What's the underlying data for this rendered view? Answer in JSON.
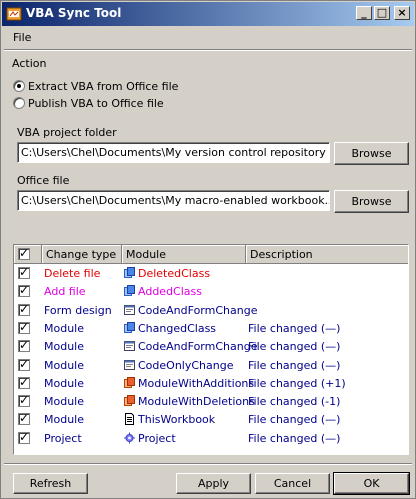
{
  "window": {
    "title": "VBA Sync Tool"
  },
  "menu": {
    "file": "File"
  },
  "action": {
    "label": "Action",
    "extract": "Extract VBA from Office file",
    "publish": "Publish VBA to Office file",
    "selected": "extract"
  },
  "folder": {
    "label": "VBA project folder",
    "value": "C:\\Users\\Chel\\Documents\\My version control repository",
    "browse": "Browse"
  },
  "office": {
    "label": "Office file",
    "value": "C:\\Users\\Chel\\Documents\\My macro-enabled workbook.xlsm",
    "browse": "Browse"
  },
  "list": {
    "columns": [
      "Change type",
      "Module",
      "Description"
    ],
    "rows": [
      {
        "type": "Delete file",
        "module": "DeletedClass",
        "desc": "",
        "color": "#e00000",
        "icon": "class-icon"
      },
      {
        "type": "Add file",
        "module": "AddedClass",
        "desc": "",
        "color": "#e000e0",
        "icon": "class-icon"
      },
      {
        "type": "Form design",
        "module": "CodeAndFormChange",
        "desc": "",
        "color": "#00008b",
        "icon": "form-icon"
      },
      {
        "type": "Module",
        "module": "ChangedClass",
        "desc": "File changed (—)",
        "color": "#00008b",
        "icon": "class-icon"
      },
      {
        "type": "Module",
        "module": "CodeAndFormChange",
        "desc": "File changed (—)",
        "color": "#00008b",
        "icon": "form-icon"
      },
      {
        "type": "Module",
        "module": "CodeOnlyChange",
        "desc": "File changed (—)",
        "color": "#00008b",
        "icon": "form-icon"
      },
      {
        "type": "Module",
        "module": "ModuleWithAdditions",
        "desc": "File changed (+1)",
        "color": "#00008b",
        "icon": "module-icon"
      },
      {
        "type": "Module",
        "module": "ModuleWithDeletions",
        "desc": "File changed (-1)",
        "color": "#00008b",
        "icon": "module-icon"
      },
      {
        "type": "Module",
        "module": "ThisWorkbook",
        "desc": "File changed (—)",
        "color": "#00008b",
        "icon": "document-icon"
      },
      {
        "type": "Project",
        "module": "Project",
        "desc": "File changed (—)",
        "color": "#00008b",
        "icon": "project-icon"
      }
    ]
  },
  "buttons": {
    "refresh": "Refresh",
    "apply": "Apply",
    "cancel": "Cancel",
    "ok": "OK"
  },
  "colors": {
    "titlebar": "#0a246a",
    "delete": "#e00000",
    "add": "#e000e0",
    "normal": "#00008b"
  }
}
